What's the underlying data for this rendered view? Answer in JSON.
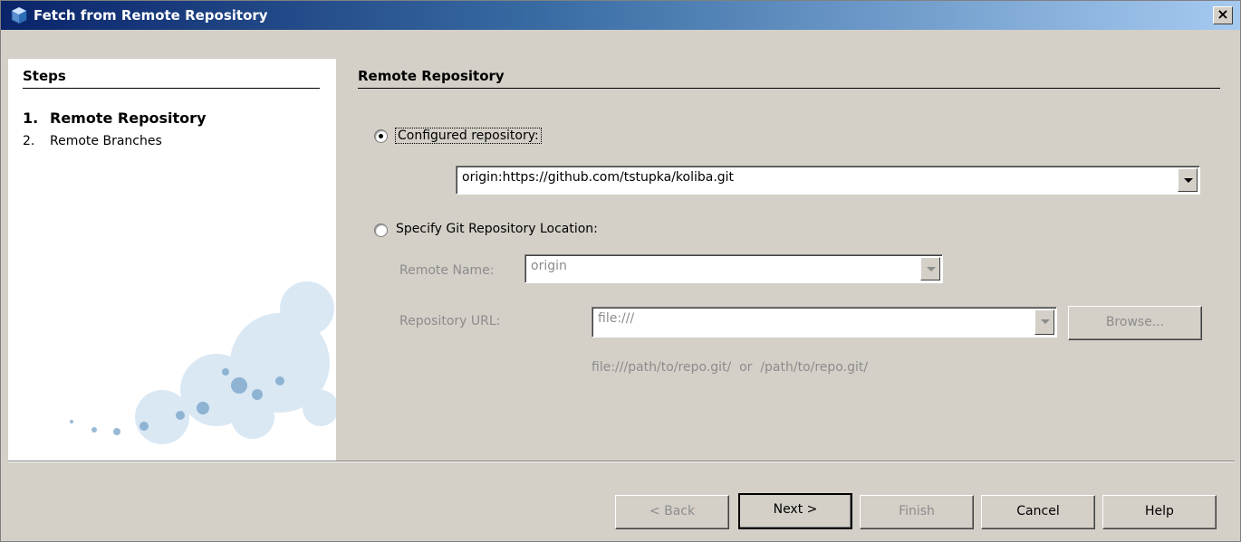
{
  "window": {
    "title": "Fetch from Remote Repository",
    "icon": "cube-icon",
    "close_label": "×"
  },
  "steps": {
    "title": "Steps",
    "items": [
      {
        "num": "1.",
        "label": "Remote Repository",
        "active": true
      },
      {
        "num": "2.",
        "label": "Remote Branches",
        "active": false
      }
    ]
  },
  "section": {
    "title": "Remote Repository"
  },
  "configured": {
    "label": "Configured repository:",
    "selected": true,
    "value": "origin:https://github.com/tstupka/koliba.git"
  },
  "specify": {
    "label": "Specify Git Repository Location:",
    "selected": false,
    "remote_name_label": "Remote Name:",
    "remote_name_value": "origin",
    "repo_url_label": "Repository URL:",
    "repo_url_value": "file:///",
    "browse_label": "Browse...",
    "hint": "file:///path/to/repo.git/  or  /path/to/repo.git/"
  },
  "footer": {
    "back_label": "< Back",
    "next_label": "Next >",
    "finish_label": "Finish",
    "cancel_label": "Cancel",
    "help_label": "Help"
  },
  "colors": {
    "title_start": "#0a246a",
    "title_end": "#a6caf0",
    "dialog_bg": "#d4d0c8",
    "disabled_text": "#8c8c8c"
  }
}
